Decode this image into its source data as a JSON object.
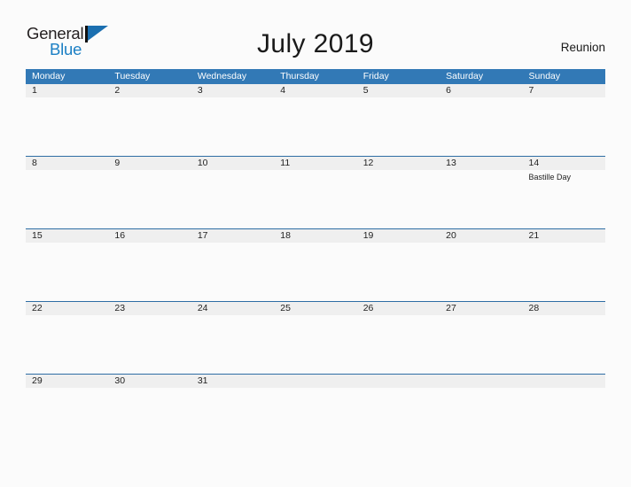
{
  "brand": {
    "name_part1": "General",
    "name_part2": "Blue",
    "flag_icon": "blue-flag-triangle"
  },
  "header": {
    "title": "July 2019",
    "region": "Reunion"
  },
  "colors": {
    "header_blue": "#3279b6",
    "row_separator_blue": "#2e6da4",
    "day_band_gray": "#efefef",
    "brand_blue": "#1b7fc4",
    "page_background": "#fbfbfb",
    "text": "#1a1a1a"
  },
  "calendar": {
    "weekdays": [
      "Monday",
      "Tuesday",
      "Wednesday",
      "Thursday",
      "Friday",
      "Saturday",
      "Sunday"
    ],
    "weeks": [
      [
        {
          "day": "1",
          "event": ""
        },
        {
          "day": "2",
          "event": ""
        },
        {
          "day": "3",
          "event": ""
        },
        {
          "day": "4",
          "event": ""
        },
        {
          "day": "5",
          "event": ""
        },
        {
          "day": "6",
          "event": ""
        },
        {
          "day": "7",
          "event": ""
        }
      ],
      [
        {
          "day": "8",
          "event": ""
        },
        {
          "day": "9",
          "event": ""
        },
        {
          "day": "10",
          "event": ""
        },
        {
          "day": "11",
          "event": ""
        },
        {
          "day": "12",
          "event": ""
        },
        {
          "day": "13",
          "event": ""
        },
        {
          "day": "14",
          "event": "Bastille Day"
        }
      ],
      [
        {
          "day": "15",
          "event": ""
        },
        {
          "day": "16",
          "event": ""
        },
        {
          "day": "17",
          "event": ""
        },
        {
          "day": "18",
          "event": ""
        },
        {
          "day": "19",
          "event": ""
        },
        {
          "day": "20",
          "event": ""
        },
        {
          "day": "21",
          "event": ""
        }
      ],
      [
        {
          "day": "22",
          "event": ""
        },
        {
          "day": "23",
          "event": ""
        },
        {
          "day": "24",
          "event": ""
        },
        {
          "day": "25",
          "event": ""
        },
        {
          "day": "26",
          "event": ""
        },
        {
          "day": "27",
          "event": ""
        },
        {
          "day": "28",
          "event": ""
        }
      ],
      [
        {
          "day": "29",
          "event": ""
        },
        {
          "day": "30",
          "event": ""
        },
        {
          "day": "31",
          "event": ""
        },
        {
          "day": "",
          "event": ""
        },
        {
          "day": "",
          "event": ""
        },
        {
          "day": "",
          "event": ""
        },
        {
          "day": "",
          "event": ""
        }
      ]
    ]
  }
}
